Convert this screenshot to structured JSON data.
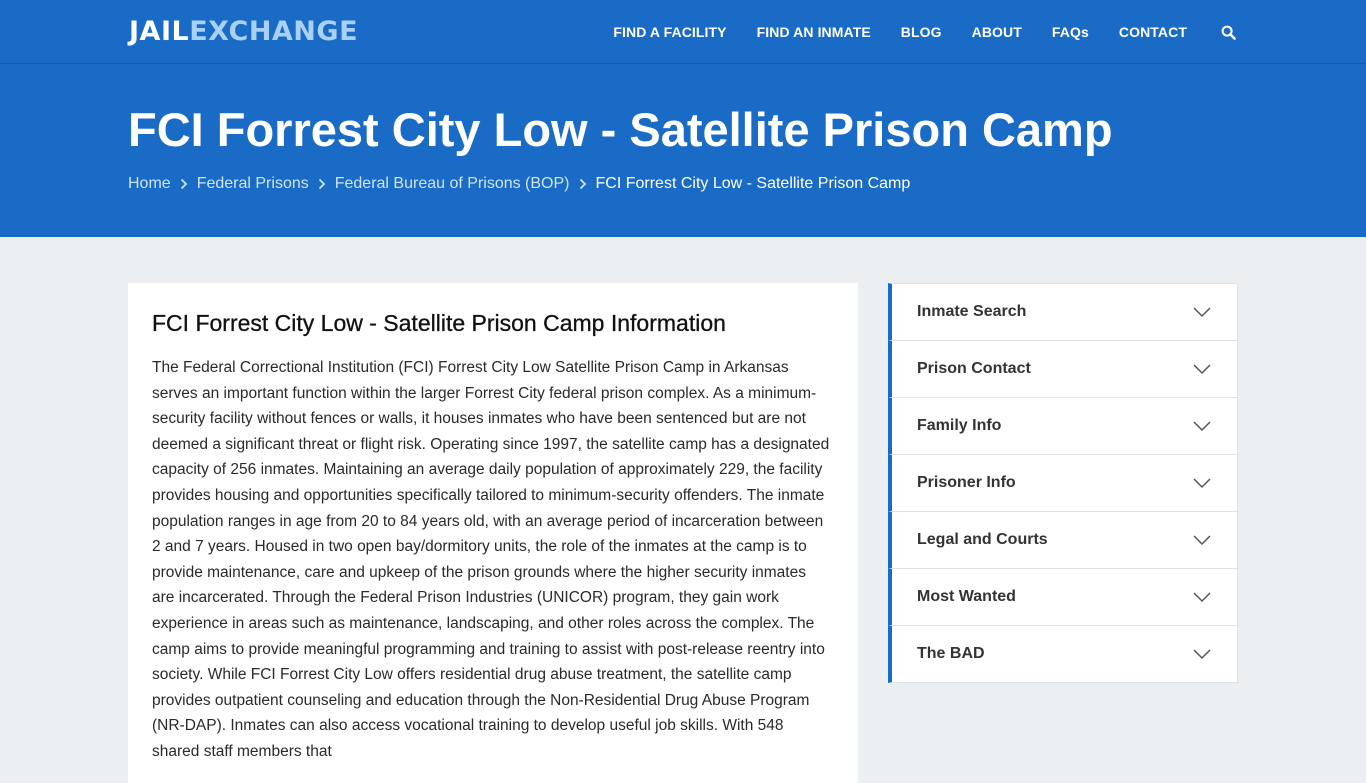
{
  "header": {
    "logo_part1": "JAIL",
    "logo_part2": "EXCHANGE",
    "nav": [
      "FIND A FACILITY",
      "FIND AN INMATE",
      "BLOG",
      "ABOUT",
      "FAQs",
      "CONTACT"
    ],
    "search_icon": "search-icon"
  },
  "hero": {
    "title": "FCI Forrest City Low - Satellite Prison Camp",
    "breadcrumbs": [
      "Home",
      "Federal Prisons",
      "Federal Bureau of Prisons (BOP)",
      "FCI Forrest City Low - Satellite Prison Camp"
    ]
  },
  "main": {
    "heading": "FCI Forrest City Low - Satellite Prison Camp Information",
    "body": "The Federal Correctional Institution (FCI) Forrest City Low Satellite Prison Camp in Arkansas serves an important function within the larger Forrest City federal prison complex. As a minimum-security facility without fences or walls, it houses inmates who have been sentenced but are not deemed a significant threat or flight risk. Operating since 1997, the satellite camp has a designated capacity of 256 inmates. Maintaining an average daily population of approximately 229, the facility provides housing and opportunities specifically tailored to minimum-security offenders. The inmate population ranges in age from 20 to 84 years old, with an average period of incarceration between 2 and 7 years. Housed in two open bay/dormitory units, the role of the inmates at the camp is to provide maintenance, care and upkeep of the prison grounds where the higher security inmates are incarcerated. Through the Federal Prison Industries (UNICOR) program, they gain work experience in areas such as maintenance, landscaping, and other roles across the complex. The camp aims to provide meaningful programming and training to assist with post-release reentry into society. While FCI Forrest City Low offers residential drug abuse treatment, the satellite camp provides outpatient counseling and education through the Non-Residential Drug Abuse Program (NR-DAP). Inmates can also access vocational training to develop useful job skills. With 548 shared staff members that"
  },
  "sidebar": {
    "items": [
      "Inmate Search",
      "Prison Contact",
      "Family Info",
      "Prisoner Info",
      "Legal and Courts",
      "Most Wanted",
      "The BAD"
    ]
  },
  "colors": {
    "brand_blue": "#1a6bc6",
    "logo_accent": "#a9d0f5",
    "page_bg": "#eceff2"
  }
}
